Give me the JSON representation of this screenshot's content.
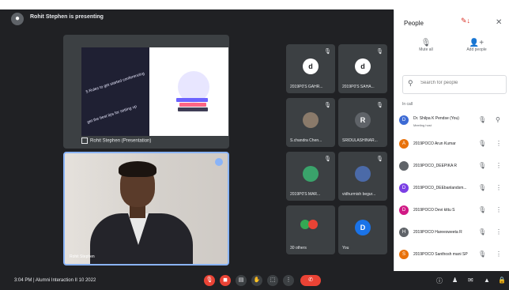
{
  "presenter_text": "Rohit Stephen is presenting",
  "share": {
    "label": "Rohit Stephen (Presentation)",
    "slide_line1": "5 Rules to get started conferencing",
    "slide_line2": "get the best tips for setting up"
  },
  "speaker": {
    "label": "Rohit Stephen"
  },
  "tiles": [
    {
      "name": "2019P0'S GAHR...",
      "avatar": "d",
      "color": "#ffffff"
    },
    {
      "name": "2019P0'S SAHA...",
      "avatar": "d",
      "color": "#ffffff"
    },
    {
      "name": "S.chandra Chen...",
      "avatar": "",
      "color": "#8a7a6a"
    },
    {
      "name": "SRIDULASHINAR...",
      "avatar": "R",
      "color": "#5f6368"
    },
    {
      "name": "2019P0'S MAR...",
      "avatar": "",
      "color": "#3aa36b"
    },
    {
      "name": "vidhurmish begur...",
      "avatar": "",
      "color": "#4b6aa8"
    },
    {
      "name": "30 others",
      "avatar": "",
      "color": "#34a853"
    },
    {
      "name": "You",
      "avatar": "D",
      "color": "#1a73e8"
    }
  ],
  "bottom": {
    "time": "3:04 PM",
    "meeting": "Alumni Interaction II 10 2022"
  },
  "people": {
    "title": "People",
    "mute_all": "Mute all",
    "add_people": "Add people",
    "search_placeholder": "Search for people",
    "in_call": "In call",
    "list": [
      {
        "name": "Dr. Shilpa K Pendse (You)",
        "sub": "Meeting host",
        "initial": "D",
        "color": "#3c6ad4"
      },
      {
        "name": "2019POCO Arun Kumar",
        "initial": "A",
        "color": "#e8710a"
      },
      {
        "name": "2019POCO_DEEPIKA R",
        "initial": "",
        "color": "#5f6368"
      },
      {
        "name": "2019POCO_DEEbanlandsm...",
        "initial": "D",
        "color": "#7b3fe4"
      },
      {
        "name": "2019POCO Devi kittu S",
        "initial": "D",
        "color": "#d01884"
      },
      {
        "name": "2019POCO Hareesweeta R",
        "initial": "H",
        "color": "#5f6368"
      },
      {
        "name": "2019POCO Santhosh mani SP",
        "initial": "S",
        "color": "#e8710a"
      }
    ]
  }
}
